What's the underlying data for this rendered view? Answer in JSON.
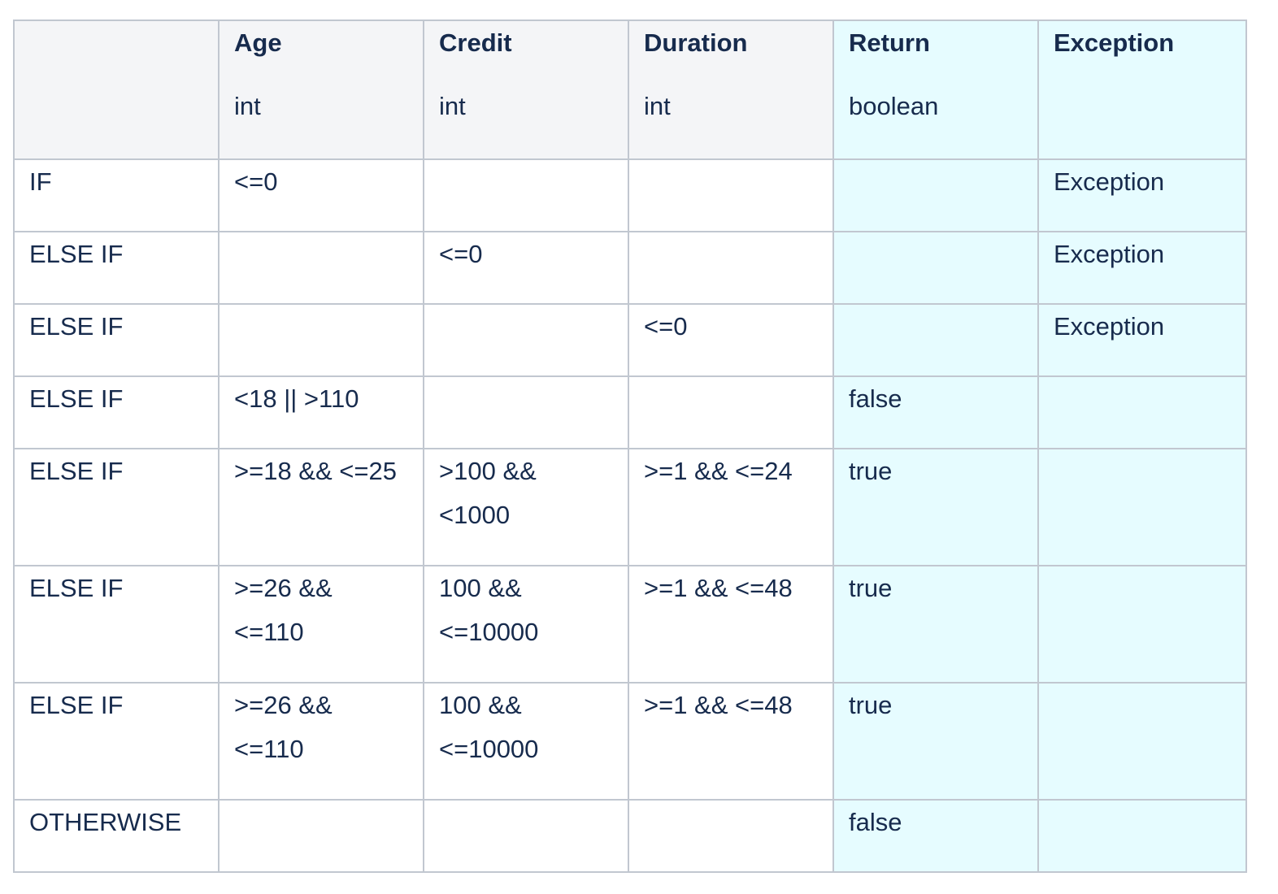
{
  "columns": [
    {
      "name": "",
      "type": ""
    },
    {
      "name": "Age",
      "type": "int"
    },
    {
      "name": "Credit",
      "type": "int"
    },
    {
      "name": "Duration",
      "type": "int"
    },
    {
      "name": "Return",
      "type": "boolean"
    },
    {
      "name": "Exception",
      "type": ""
    }
  ],
  "rows": [
    {
      "condition": "IF",
      "age": "<=0",
      "credit": "",
      "duration": "",
      "return": "",
      "exception": "Exception"
    },
    {
      "condition": "ELSE IF",
      "age": "",
      "credit": "<=0",
      "duration": "",
      "return": "",
      "exception": "Exception"
    },
    {
      "condition": "ELSE IF",
      "age": "",
      "credit": "",
      "duration": "<=0",
      "return": "",
      "exception": "Exception"
    },
    {
      "condition": "ELSE IF",
      "age": "<18 || >110",
      "credit": "",
      "duration": "",
      "return": "false",
      "exception": ""
    },
    {
      "condition": "ELSE IF",
      "age": ">=18 && <=25",
      "credit": ">100 && <1000",
      "duration": ">=1 && <=24",
      "return": "true",
      "exception": ""
    },
    {
      "condition": "ELSE IF",
      "age": ">=26 && <=110",
      "credit": "100 && <=10000",
      "duration": ">=1 && <=48",
      "return": "true",
      "exception": ""
    },
    {
      "condition": "ELSE IF",
      "age": ">=26 && <=110",
      "credit": "100 && <=10000",
      "duration": ">=1 && <=48",
      "return": "true",
      "exception": ""
    },
    {
      "condition": "OTHERWISE",
      "age": "",
      "credit": "",
      "duration": "",
      "return": "false",
      "exception": ""
    }
  ],
  "colors": {
    "border": "#c1c7d0",
    "header_bg": "#f4f5f7",
    "output_bg": "#e6fcff",
    "text": "#172b4d"
  }
}
